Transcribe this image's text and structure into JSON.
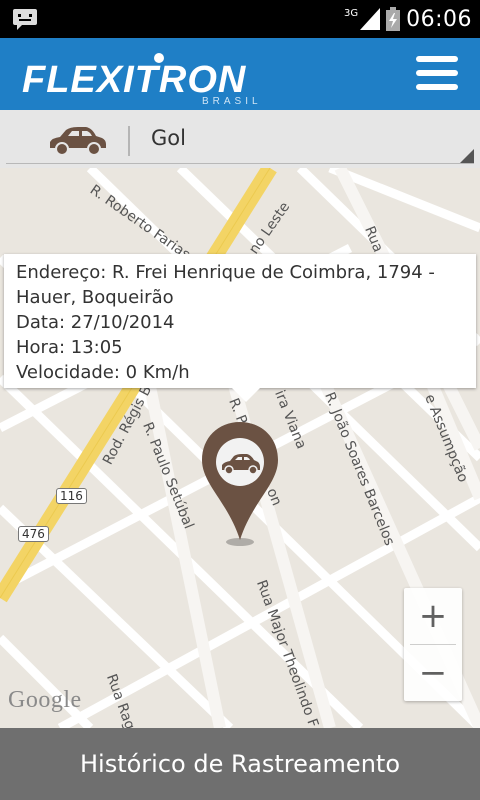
{
  "status_bar": {
    "network": "3G",
    "time": "06:06",
    "icons": [
      "notification-icon",
      "signal-icon",
      "battery-icon"
    ]
  },
  "app_bar": {
    "logo_text": "FLEXITRON",
    "logo_subtext": "BRASIL",
    "brand_color": "#1f7fc6",
    "menu_icon": "hamburger-menu-icon"
  },
  "vehicle_selector": {
    "selected": "Gol",
    "icon": "car-icon"
  },
  "map": {
    "streets": [
      {
        "id": "s1",
        "label": "R. Roberto Farias"
      },
      {
        "id": "s2",
        "label": "no Leste"
      },
      {
        "id": "s3",
        "label": "Rua"
      },
      {
        "id": "s4",
        "label": "Rod. Régis B"
      },
      {
        "id": "s5",
        "label": "R. Paulo Setúbal"
      },
      {
        "id": "s6",
        "label": "ira Viana"
      },
      {
        "id": "s7",
        "label": "R. João Soares Barcelos"
      },
      {
        "id": "s8",
        "label": "e Assumpção"
      },
      {
        "id": "s9",
        "label": "Rua Major Theolindo F"
      },
      {
        "id": "s10",
        "label": "Rua Rag"
      },
      {
        "id": "s11",
        "label": "R. P"
      },
      {
        "id": "s12",
        "label": "on"
      }
    ],
    "route_shields": [
      {
        "label": "116"
      },
      {
        "label": "476"
      }
    ],
    "attribution": "Google",
    "info_window": {
      "address_line1": "Endereço: R. Frei Henrique de Coimbra, 1794 -",
      "address_line2": "Hauer, Boqueirão",
      "date": "Data: 27/10/2014",
      "time": "Hora: 13:05",
      "speed": "Velocidade: 0 Km/h"
    },
    "marker_icon": "car-location-pin-icon",
    "marker_color": "#6b5243",
    "zoom": {
      "in": "+",
      "out": "−"
    }
  },
  "bottom_action": {
    "label": "Histórico de Rastreamento"
  }
}
